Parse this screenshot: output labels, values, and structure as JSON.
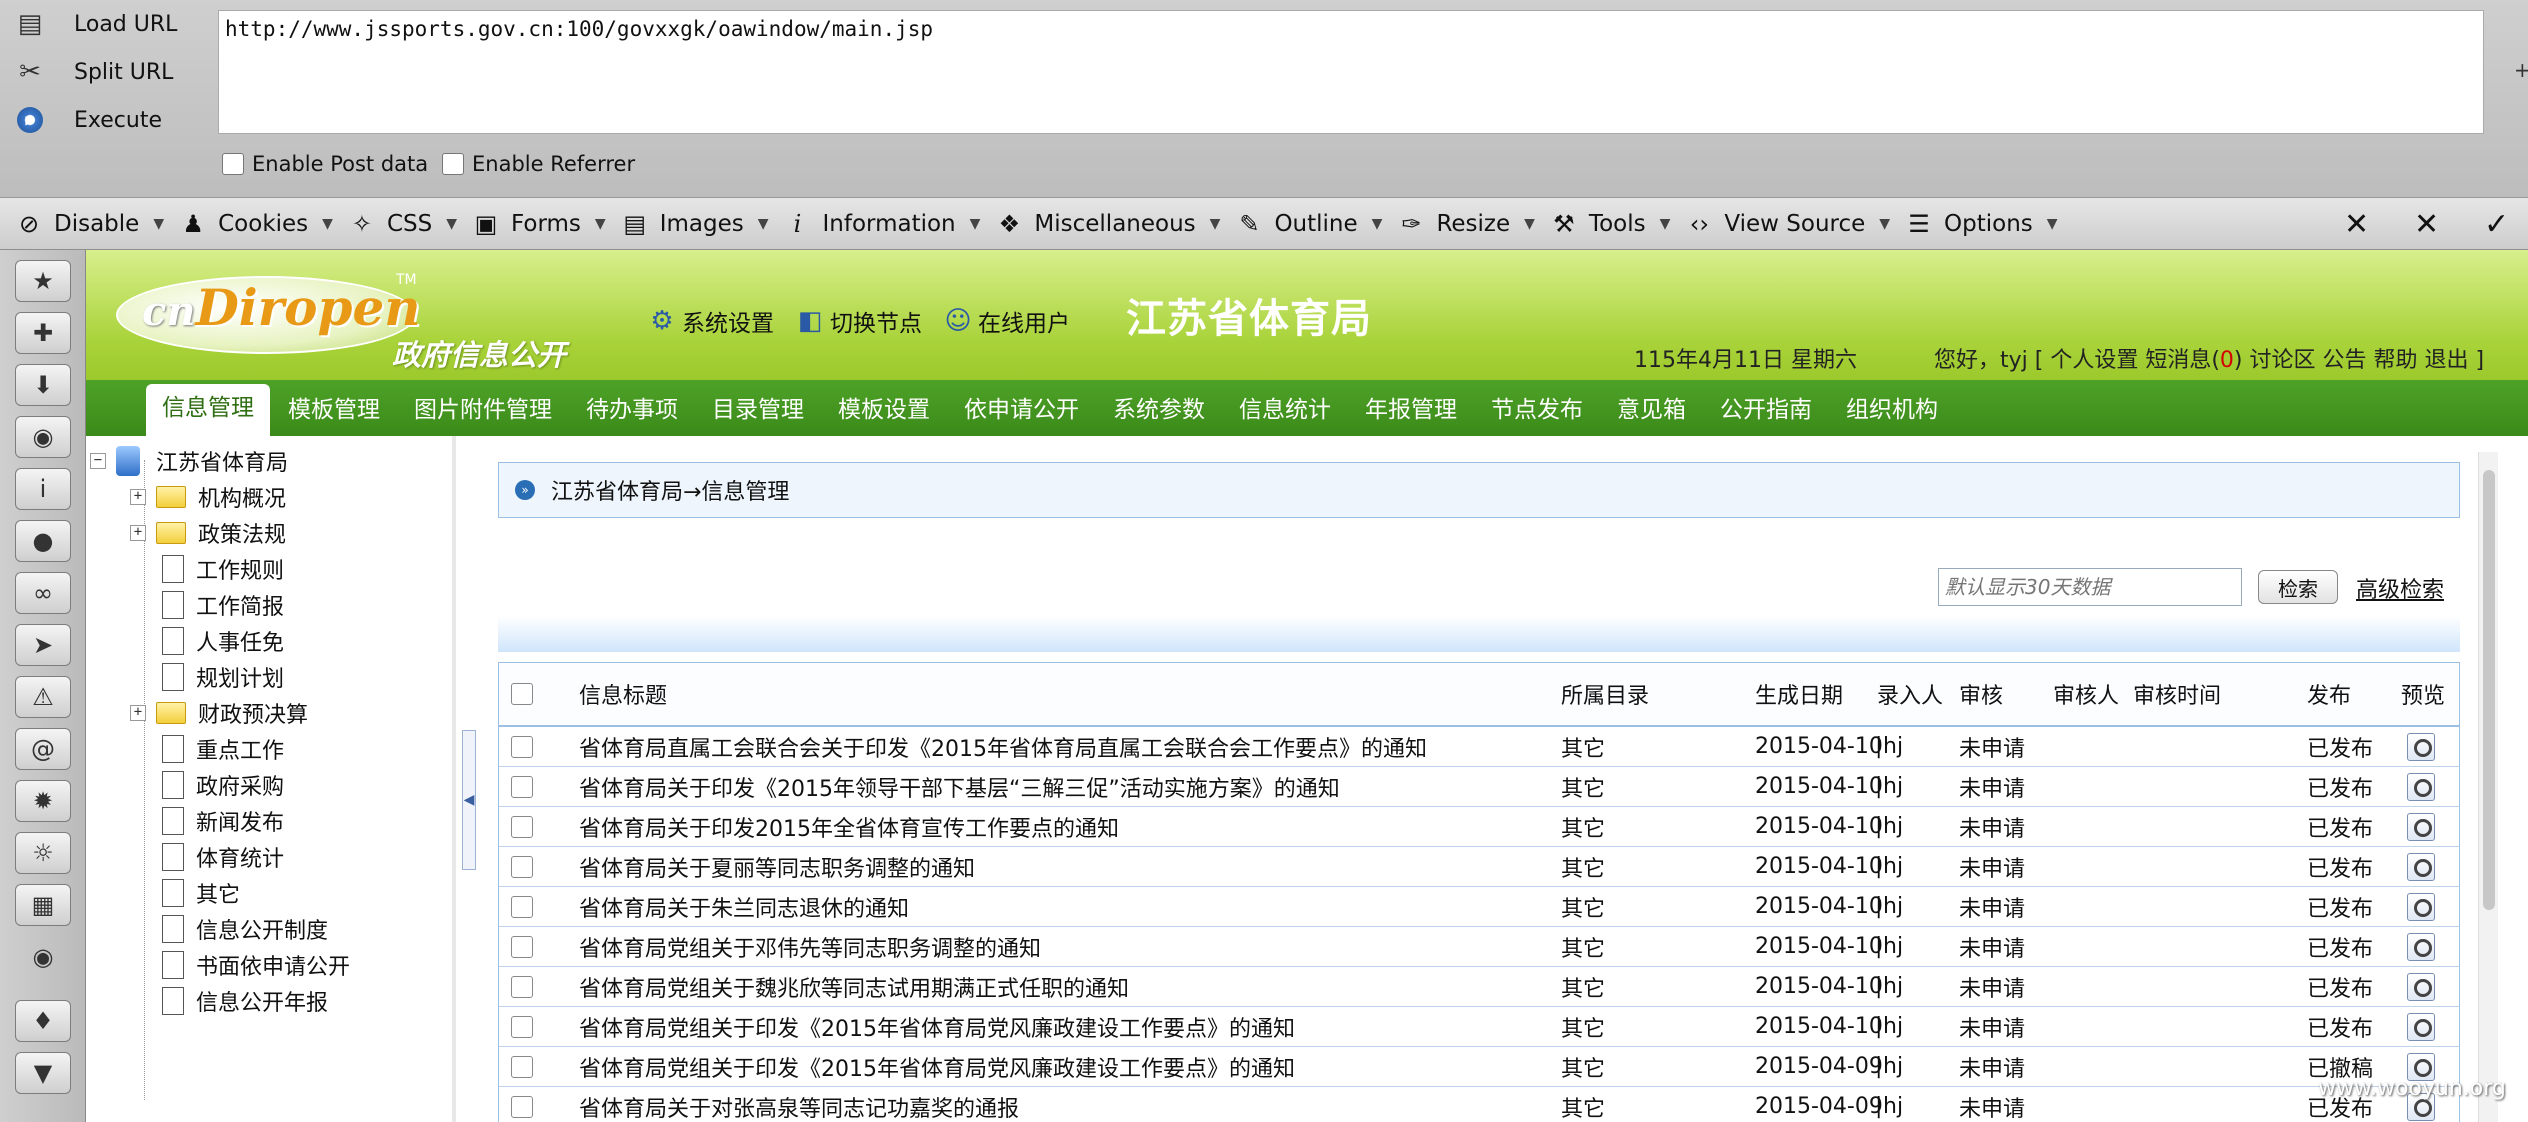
{
  "hackbar": {
    "buttons": [
      {
        "label": "Load URL",
        "icon": "load-url-icon"
      },
      {
        "label": "Split URL",
        "icon": "split-url-icon"
      },
      {
        "label": "Execute",
        "icon": "execute-icon"
      }
    ],
    "url": "http://www.jssports.gov.cn:100/govxxgk/oawindow/main.jsp",
    "enable_post": "Enable Post data",
    "enable_referrer": "Enable Referrer",
    "plus": "+"
  },
  "devbar": {
    "items": [
      {
        "label": "Disable",
        "icon": "disable-icon"
      },
      {
        "label": "Cookies",
        "icon": "cookies-icon"
      },
      {
        "label": "CSS",
        "icon": "css-icon"
      },
      {
        "label": "Forms",
        "icon": "forms-icon"
      },
      {
        "label": "Images",
        "icon": "images-icon"
      },
      {
        "label": "Information",
        "icon": "information-icon"
      },
      {
        "label": "Miscellaneous",
        "icon": "miscellaneous-icon"
      },
      {
        "label": "Outline",
        "icon": "outline-icon"
      },
      {
        "label": "Resize",
        "icon": "resize-icon"
      },
      {
        "label": "Tools",
        "icon": "tools-icon"
      },
      {
        "label": "View Source",
        "icon": "view-source-icon"
      },
      {
        "label": "Options",
        "icon": "options-icon"
      }
    ]
  },
  "header": {
    "logo_cn": "cn",
    "logo_brand": "Diropen",
    "logo_tm": "TM",
    "logo_sub": "政府信息公开",
    "links": [
      "系统设置",
      "切换节点",
      "在线用户"
    ],
    "site_title": "江苏省体育局",
    "date": "115年4月11日 星期六",
    "user_prefix": "您好，tyj [ 个人设置 短消息(",
    "unread": "0",
    "user_suffix": ") 讨论区 公告 帮助 退出 ]"
  },
  "menu": [
    "信息管理",
    "模板管理",
    "图片附件管理",
    "待办事项",
    "目录管理",
    "模板设置",
    "依申请公开",
    "系统参数",
    "信息统计",
    "年报管理",
    "节点发布",
    "意见箱",
    "公开指南",
    "组织机构"
  ],
  "tree": {
    "root": "江苏省体育局",
    "items": [
      {
        "label": "机构概况",
        "type": "folder"
      },
      {
        "label": "政策法规",
        "type": "folder"
      },
      {
        "label": "工作规则",
        "type": "doc"
      },
      {
        "label": "工作简报",
        "type": "doc"
      },
      {
        "label": "人事任免",
        "type": "doc"
      },
      {
        "label": "规划计划",
        "type": "doc"
      },
      {
        "label": "财政预决算",
        "type": "folder"
      },
      {
        "label": "重点工作",
        "type": "doc"
      },
      {
        "label": "政府采购",
        "type": "doc"
      },
      {
        "label": "新闻发布",
        "type": "doc"
      },
      {
        "label": "体育统计",
        "type": "doc"
      },
      {
        "label": "其它",
        "type": "doc"
      },
      {
        "label": "信息公开制度",
        "type": "doc"
      },
      {
        "label": "书面依申请公开",
        "type": "doc"
      },
      {
        "label": "信息公开年报",
        "type": "doc"
      }
    ]
  },
  "content": {
    "breadcrumb": "江苏省体育局→信息管理",
    "search_placeholder": "默认显示30天数据",
    "search_button": "检索",
    "advanced_search": "高级检索",
    "columns": [
      "信息标题",
      "所属目录",
      "生成日期",
      "录入人",
      "审核",
      "审核人",
      "审核时间",
      "发布",
      "预览"
    ],
    "rows": [
      {
        "title": "省体育局直属工会联合会关于印发《2015年省体育局直属工会联合会工作要点》的通知",
        "category": "其它",
        "date": "2015-04-10",
        "entered_by": "hj",
        "review": "未申请",
        "reviewer": "",
        "review_time": "",
        "publish": "已发布"
      },
      {
        "title": "省体育局关于印发《2015年领导干部下基层“三解三促”活动实施方案》的通知",
        "category": "其它",
        "date": "2015-04-10",
        "entered_by": "hj",
        "review": "未申请",
        "reviewer": "",
        "review_time": "",
        "publish": "已发布"
      },
      {
        "title": "省体育局关于印发2015年全省体育宣传工作要点的通知",
        "category": "其它",
        "date": "2015-04-10",
        "entered_by": "hj",
        "review": "未申请",
        "reviewer": "",
        "review_time": "",
        "publish": "已发布"
      },
      {
        "title": "省体育局关于夏丽等同志职务调整的通知",
        "category": "其它",
        "date": "2015-04-10",
        "entered_by": "hj",
        "review": "未申请",
        "reviewer": "",
        "review_time": "",
        "publish": "已发布"
      },
      {
        "title": "省体育局关于朱兰同志退休的通知",
        "category": "其它",
        "date": "2015-04-10",
        "entered_by": "hj",
        "review": "未申请",
        "reviewer": "",
        "review_time": "",
        "publish": "已发布"
      },
      {
        "title": "省体育局党组关于邓伟先等同志职务调整的通知",
        "category": "其它",
        "date": "2015-04-10",
        "entered_by": "hj",
        "review": "未申请",
        "reviewer": "",
        "review_time": "",
        "publish": "已发布"
      },
      {
        "title": "省体育局党组关于魏兆欣等同志试用期满正式任职的通知",
        "category": "其它",
        "date": "2015-04-10",
        "entered_by": "hj",
        "review": "未申请",
        "reviewer": "",
        "review_time": "",
        "publish": "已发布"
      },
      {
        "title": "省体育局党组关于印发《2015年省体育局党风廉政建设工作要点》的通知",
        "category": "其它",
        "date": "2015-04-10",
        "entered_by": "hj",
        "review": "未申请",
        "reviewer": "",
        "review_time": "",
        "publish": "已发布"
      },
      {
        "title": "省体育局党组关于印发《2015年省体育局党风廉政建设工作要点》的通知",
        "category": "其它",
        "date": "2015-04-09",
        "entered_by": "hj",
        "review": "未申请",
        "reviewer": "",
        "review_time": "",
        "publish": "已撤稿"
      },
      {
        "title": "省体育局关于对张高泉等同志记功嘉奖的通报",
        "category": "其它",
        "date": "2015-04-09",
        "entered_by": "hj",
        "review": "未申请",
        "reviewer": "",
        "review_time": "",
        "publish": "已发布"
      }
    ]
  },
  "watermark": "www.wooyun.org"
}
